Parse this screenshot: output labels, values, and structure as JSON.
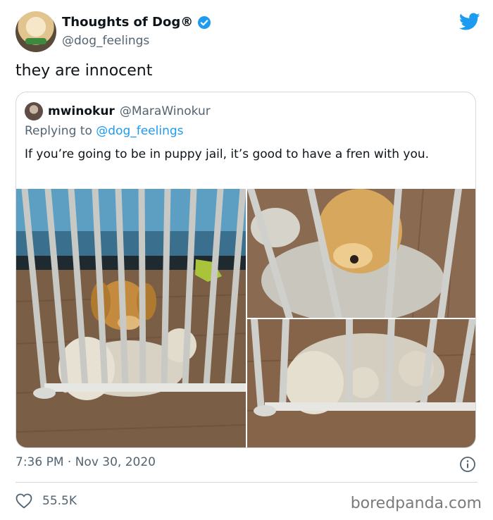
{
  "tweet": {
    "display_name": "Thoughts of Dog®",
    "handle": "@dog_feelings",
    "text": "they are innocent",
    "timestamp": "7:36 PM · Nov 30, 2020",
    "likes": "55.5K"
  },
  "quoted_tweet": {
    "display_name": "mwinokur",
    "handle": "@MaraWinokur",
    "reply_prefix": "Replying to ",
    "reply_to": "@dog_feelings",
    "text": "If you’re going to be in puppy jail, it’s good to have a fren with you."
  },
  "icons": {
    "verified": "verified-badge-icon",
    "brand": "twitter-bird-icon",
    "info": "info-icon",
    "like": "heart-icon"
  },
  "colors": {
    "twitter_blue": "#1d9bf0",
    "secondary_text": "#536471",
    "border": "#cfd9de"
  },
  "watermark": "boredpanda.com"
}
